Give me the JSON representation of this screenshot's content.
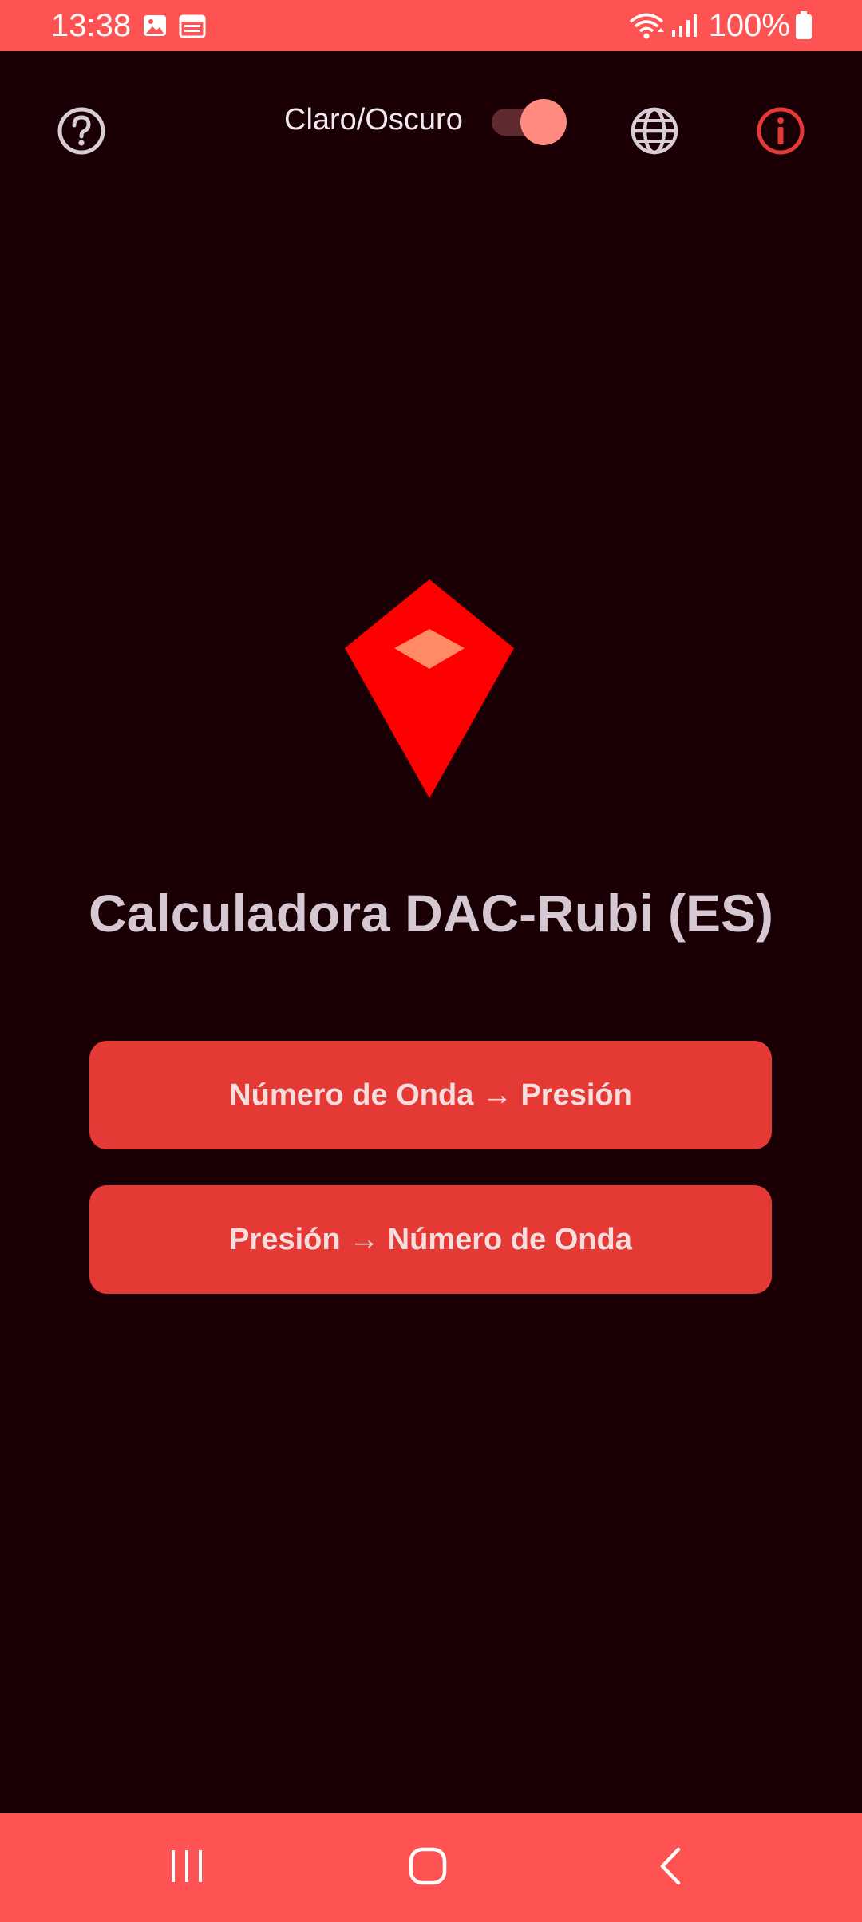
{
  "status_bar": {
    "time": "13:38",
    "battery_text": "100%",
    "icons": [
      "image-icon",
      "calendar-icon",
      "wifi-icon",
      "signal-icon",
      "battery-icon"
    ]
  },
  "header": {
    "help_icon": "help-circle-icon",
    "theme_toggle_label": "Claro/Oscuro",
    "theme_toggle_on": true,
    "language_icon": "globe-icon",
    "info_icon": "info-circle-icon"
  },
  "main": {
    "logo_icon": "ruby-gem-icon",
    "title": "Calculadora DAC-Rubi (ES)",
    "buttons": [
      {
        "label": "Número de Onda → Presión"
      },
      {
        "label": "Presión → Número de Onda"
      }
    ]
  },
  "nav_bar": {
    "icons": [
      "recent-apps-icon",
      "home-icon",
      "back-icon"
    ]
  },
  "colors": {
    "background": "#1a0004",
    "accent": "#ff5252",
    "button": "#e53935",
    "logo_red": "#ff0000",
    "logo_facet": "#ff8a65",
    "title_text": "#d6c8d3",
    "info_icon": "#e53935"
  }
}
